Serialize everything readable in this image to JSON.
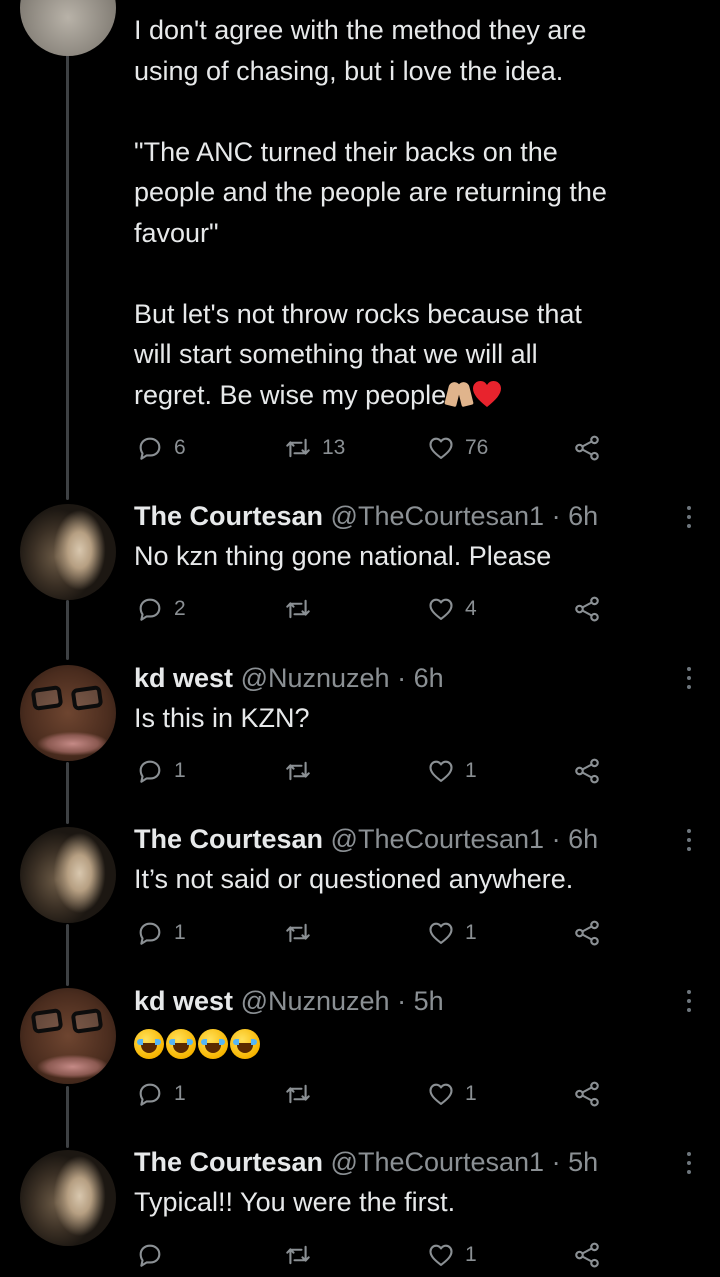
{
  "main_tweet": {
    "text": "I don't agree with the method they are\nusing of chasing, but i love the idea.\n\n\"The ANC turned their backs on the\npeople and the people are returning the\nfavour\"\n\nBut let's not throw rocks because that\nwill start something that we will all\nregret. Be wise my people",
    "trailing_emoji": [
      "folded-hands",
      "red-heart"
    ],
    "stats": {
      "replies": "6",
      "retweets": "13",
      "likes": "76"
    }
  },
  "replies": [
    {
      "name": "The Courtesan",
      "handle": "@TheCourtesan1",
      "separator": "·",
      "time": "6h",
      "text": "No kzn thing gone national. Please",
      "stats": {
        "replies": "2",
        "retweets": "",
        "likes": "4"
      }
    },
    {
      "name": "kd west",
      "handle": "@Nuznuzeh",
      "separator": "·",
      "time": "6h",
      "text": "Is this in KZN?",
      "stats": {
        "replies": "1",
        "retweets": "",
        "likes": "1"
      }
    },
    {
      "name": "The Courtesan",
      "handle": "@TheCourtesan1",
      "separator": "·",
      "time": "6h",
      "text": "It’s not said or questioned anywhere.",
      "stats": {
        "replies": "1",
        "retweets": "",
        "likes": "1"
      }
    },
    {
      "name": "kd west",
      "handle": "@Nuznuzeh",
      "separator": "·",
      "time": "5h",
      "text": "",
      "emoji": [
        "face-with-tears-of-joy",
        "face-with-tears-of-joy",
        "face-with-tears-of-joy",
        "face-with-tears-of-joy"
      ],
      "stats": {
        "replies": "1",
        "retweets": "",
        "likes": "1"
      }
    },
    {
      "name": "The Courtesan",
      "handle": "@TheCourtesan1",
      "separator": "·",
      "time": "5h",
      "text": "Typical!! You were the first.",
      "stats": {
        "replies": "",
        "retweets": "",
        "likes": "1"
      }
    }
  ],
  "icons": {
    "reply": "reply-icon",
    "retweet": "retweet-icon",
    "like": "like-icon",
    "share": "share-icon",
    "more": "more-options-icon"
  },
  "colors": {
    "background": "#000000",
    "text": "#e7e9ea",
    "secondary": "#8b9094",
    "thread_line": "#3e4144"
  }
}
